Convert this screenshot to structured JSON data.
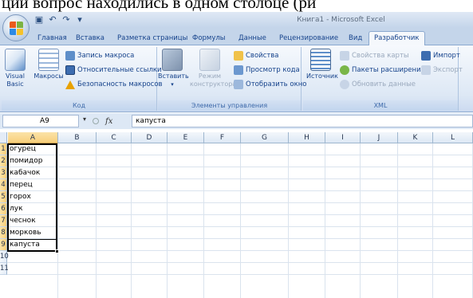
{
  "doc_text": "ции вопрос находились в одном столбце (ри",
  "window": {
    "title": "Книга1 - Microsoft Excel"
  },
  "qat": [
    {
      "name": "save-icon",
      "glyph": "▣"
    },
    {
      "name": "undo-icon",
      "glyph": "↶"
    },
    {
      "name": "redo-icon",
      "glyph": "↷"
    },
    {
      "name": "customize-qat-icon",
      "glyph": "▾"
    }
  ],
  "tabs": [
    {
      "label": "Главная",
      "active": false
    },
    {
      "label": "Вставка",
      "active": false
    },
    {
      "label": "Разметка страницы",
      "active": false
    },
    {
      "label": "Формулы",
      "active": false
    },
    {
      "label": "Данные",
      "active": false
    },
    {
      "label": "Рецензирование",
      "active": false
    },
    {
      "label": "Вид",
      "active": false
    },
    {
      "label": "Разработчик",
      "active": true
    }
  ],
  "ribbon": {
    "code": {
      "label": "Код",
      "visual_basic": "Visual Basic",
      "macros": "Макросы",
      "record_macro": "Запись макроса",
      "relative_refs": "Относительные ссылки",
      "macro_security": "Безопасность макросов"
    },
    "controls": {
      "label": "Элементы управления",
      "insert": "Вставить",
      "design_mode": "Режим конструктора",
      "properties": "Свойства",
      "view_code": "Просмотр кода",
      "run_dialog": "Отобразить окно"
    },
    "xml": {
      "label": "XML",
      "source": "Источник",
      "map_properties": "Свойства карты",
      "expansion_packs": "Пакеты расширения",
      "refresh_data": "Обновить данные",
      "import": "Импорт",
      "export": "Экспорт"
    }
  },
  "formula_bar": {
    "name_box": "A9",
    "fx_label": "fx",
    "content": "капуста"
  },
  "columns": [
    "A",
    "B",
    "C",
    "D",
    "E",
    "F",
    "G",
    "H",
    "I",
    "J",
    "K",
    "L"
  ],
  "rows": [
    "1",
    "2",
    "3",
    "4",
    "5",
    "6",
    "7",
    "8",
    "9",
    "10",
    "11"
  ],
  "cells": [
    "огурец",
    "помидор",
    "кабачок",
    "перец",
    "горох",
    "лук",
    "чеснок",
    "морковь",
    "капуста"
  ],
  "colors": {
    "ribbon_text": "#15428b",
    "selected_header": "#f8cf7a",
    "warning": "#e8a200"
  }
}
